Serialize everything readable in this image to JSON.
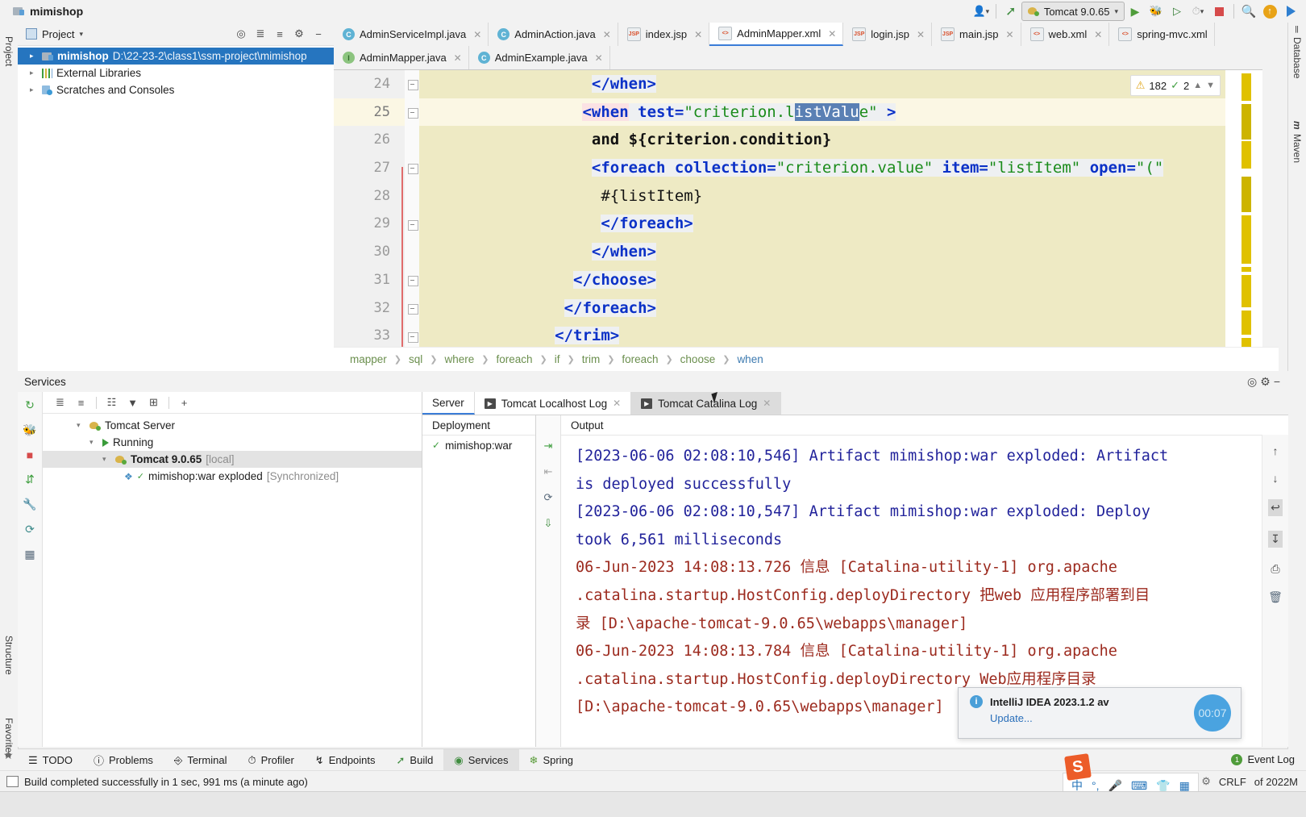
{
  "titlebar": {
    "project_name": "mimishop",
    "project_icon": "folder-module-icon",
    "account_icon": "user-avatar-icon",
    "build_icon": "hammer-build-icon",
    "run_config": {
      "label": "Tomcat 9.0.65",
      "icon": "tomcat-cat-icon",
      "dropdown_icon": "chevron-down-icon"
    },
    "actions": [
      {
        "name": "run-button",
        "glyph": "↪"
      },
      {
        "name": "debug-button",
        "glyph": "☸"
      },
      {
        "name": "run-with-coverage-button",
        "glyph": "▶"
      },
      {
        "name": "profiler-button",
        "glyph": "◴"
      },
      {
        "name": "stop-button",
        "glyph": "■"
      },
      {
        "name": "search-everywhere-button",
        "glyph": "⌕"
      },
      {
        "name": "updates-button",
        "glyph": "↑"
      },
      {
        "name": "next-button",
        "glyph": "▶"
      }
    ]
  },
  "left_rail": {
    "project_label": "Project",
    "structure_label": "Structure",
    "favorites_label": "Favorites",
    "star_icon": "star-icon"
  },
  "right_rail": {
    "database_label": "Database",
    "maven_label": "Maven"
  },
  "project_window": {
    "title": "Project",
    "dropdown_icon": "chevron-down-icon",
    "toolbar_icons": [
      "locate-icon",
      "expand-all-icon",
      "collapse-all-icon",
      "settings-gear-icon",
      "hide-icon"
    ],
    "tree": [
      {
        "label": "mimishop",
        "path": "D:\\22-23-2\\class1\\ssm-project\\mimishop",
        "icon": "project-folder-icon",
        "selected": true,
        "indent": 0
      },
      {
        "label": "External Libraries",
        "path": "",
        "icon": "libraries-icon",
        "selected": false,
        "indent": 0
      },
      {
        "label": "Scratches and Consoles",
        "path": "",
        "icon": "scratches-icon",
        "selected": false,
        "indent": 0
      }
    ]
  },
  "editor": {
    "tabs_row1": [
      {
        "label": "AdminServiceImpl.java",
        "icon": "java-class-icon",
        "active": false,
        "closable": true
      },
      {
        "label": "AdminAction.java",
        "icon": "java-class-icon",
        "active": false,
        "closable": true
      },
      {
        "label": "index.jsp",
        "icon": "jsp-file-icon",
        "active": false,
        "closable": true
      },
      {
        "label": "AdminMapper.xml",
        "icon": "xml-file-icon",
        "active": true,
        "closable": true
      },
      {
        "label": "login.jsp",
        "icon": "jsp-file-icon",
        "active": false,
        "closable": true
      },
      {
        "label": "main.jsp",
        "icon": "jsp-file-icon",
        "active": false,
        "closable": true
      },
      {
        "label": "web.xml",
        "icon": "xml-file-icon",
        "active": false,
        "closable": true
      },
      {
        "label": "spring-mvc.xml",
        "icon": "xml-file-icon",
        "active": false,
        "closable": true
      }
    ],
    "tabs_row2": [
      {
        "label": "AdminMapper.java",
        "icon": "java-interface-icon",
        "active": false,
        "closable": true
      },
      {
        "label": "AdminExample.java",
        "icon": "java-class-icon",
        "active": false,
        "closable": true
      }
    ],
    "inspection_widget": {
      "warning_count": "182",
      "ok_count": "2",
      "warning_icon": "warning-triangle-icon",
      "ok_icon": "checkmark-icon",
      "up_icon": "chevron-up-icon",
      "down_icon": "chevron-down-icon"
    },
    "line_numbers": [
      "24",
      "25",
      "26",
      "27",
      "28",
      "29",
      "30",
      "31",
      "32",
      "33"
    ],
    "current_line": "25",
    "selected_text": "istValu",
    "code_lines": [
      {
        "num": "24",
        "indent": 18,
        "text": "</when>"
      },
      {
        "num": "25",
        "indent": 17,
        "text": "<when test=\"criterion.listValue\" >"
      },
      {
        "num": "26",
        "indent": 18,
        "text": "and ${criterion.condition}"
      },
      {
        "num": "27",
        "indent": 18,
        "text": "<foreach collection=\"criterion.value\" item=\"listItem\" open=\"(\""
      },
      {
        "num": "28",
        "indent": 19,
        "text": "#{listItem}"
      },
      {
        "num": "29",
        "indent": 19,
        "text": "</foreach>"
      },
      {
        "num": "30",
        "indent": 18,
        "text": "</when>"
      },
      {
        "num": "31",
        "indent": 16,
        "text": "</choose>"
      },
      {
        "num": "32",
        "indent": 15,
        "text": "</foreach>"
      },
      {
        "num": "33",
        "indent": 14,
        "text": "</trim>"
      }
    ],
    "breadcrumbs": [
      "mapper",
      "sql",
      "where",
      "foreach",
      "if",
      "trim",
      "foreach",
      "choose",
      "when"
    ]
  },
  "services": {
    "title": "Services",
    "header_icons": [
      "locate-icon",
      "settings-gear-icon",
      "hide-icon"
    ],
    "rail_icons": [
      "rerun-icon",
      "debug-icon",
      "stop-icon",
      "redeploy-icon",
      "settings-wrench-icon",
      "restart-icon",
      "layout-icon"
    ],
    "toolbar_icons": [
      "expand-all-icon",
      "collapse-all-icon",
      "group-icon",
      "filter-icon",
      "add-tab-icon",
      "add-icon"
    ],
    "tree": [
      {
        "label": "Tomcat Server",
        "suffix": "",
        "icon": "tomcat-cat-icon",
        "indent": 0,
        "bold": false,
        "selected": false,
        "arrow": "⌄"
      },
      {
        "label": "Running",
        "suffix": "",
        "icon": "run-green-icon",
        "indent": 1,
        "bold": false,
        "selected": false,
        "arrow": "⌄"
      },
      {
        "label": "Tomcat 9.0.65",
        "suffix": "[local]",
        "icon": "tomcat-cat-icon",
        "indent": 2,
        "bold": true,
        "selected": true,
        "arrow": "⌄"
      },
      {
        "label": "mimishop:war exploded",
        "suffix": "[Synchronized]",
        "icon": "artifact-icon",
        "indent": 3,
        "bold": false,
        "selected": false,
        "arrow": ""
      }
    ],
    "console_tabs": [
      {
        "label": "Server",
        "icon": "",
        "active": true,
        "closable": false
      },
      {
        "label": "Tomcat Localhost Log",
        "icon": "log-icon",
        "active": false,
        "closable": true
      },
      {
        "label": "Tomcat Catalina Log",
        "icon": "log-icon",
        "active": false,
        "closable": true,
        "hovered": true
      }
    ],
    "deployment": {
      "column_header": "Deployment",
      "items": [
        {
          "label": "mimishop:war",
          "status_icon": "checkmark-icon"
        }
      ],
      "side_icons": [
        "deploy-icon",
        "undeploy-icon",
        "redeploy-icon",
        "update-icon"
      ]
    },
    "output": {
      "column_header": "Output",
      "side_icons": [
        "scroll-up-icon",
        "scroll-down-icon",
        "soft-wrap-icon",
        "scroll-to-end-icon",
        "print-icon",
        "clear-all-icon"
      ],
      "lines": [
        {
          "color": "blue",
          "text": "[2023-06-06 02:08:10,546] Artifact mimishop:war exploded: Artifact"
        },
        {
          "color": "blue",
          "text": "  is deployed successfully"
        },
        {
          "color": "blue",
          "text": "[2023-06-06 02:08:10,547] Artifact mimishop:war exploded: Deploy"
        },
        {
          "color": "blue",
          "text": "  took 6,561 milliseconds"
        },
        {
          "color": "red",
          "text": "06-Jun-2023 14:08:13.726 信息 [Catalina-utility-1] org.apache"
        },
        {
          "color": "red",
          "text": "  .catalina.startup.HostConfig.deployDirectory 把web 应用程序部署到目"
        },
        {
          "color": "red",
          "text": "  录 [D:\\apache-tomcat-9.0.65\\webapps\\manager]"
        },
        {
          "color": "red",
          "text": "06-Jun-2023 14:08:13.784 信息 [Catalina-utility-1] org.apache"
        },
        {
          "color": "red",
          "text": "  .catalina.startup.HostConfig.deployDirectory Web应用程序目录"
        },
        {
          "color": "red",
          "text": "  [D:\\apache-tomcat-9.0.65\\webapps\\manager]"
        }
      ]
    }
  },
  "notification": {
    "info_icon": "info-icon",
    "title": "IntelliJ IDEA 2023.1.2 av",
    "link": "Update...",
    "timer": "00:07"
  },
  "tool_strip": [
    {
      "label": "TODO",
      "icon": "todo-icon",
      "active": false
    },
    {
      "label": "Problems",
      "icon": "problems-icon",
      "active": false
    },
    {
      "label": "Terminal",
      "icon": "terminal-icon",
      "active": false
    },
    {
      "label": "Profiler",
      "icon": "profiler-icon",
      "active": false
    },
    {
      "label": "Endpoints",
      "icon": "endpoints-icon",
      "active": false
    },
    {
      "label": "Build",
      "icon": "build-hammer-icon",
      "active": false
    },
    {
      "label": "Services",
      "icon": "services-icon",
      "active": true
    },
    {
      "label": "Spring",
      "icon": "spring-leaf-icon",
      "active": false
    }
  ],
  "status_bar": {
    "icon": "build-status-icon",
    "message": "Build completed successfully in 1 sec, 991 ms (a minute ago)",
    "event_log": "Event Log",
    "event_count": "1",
    "line_separator": "CRLF",
    "memory": "of 2022M",
    "settings_icon": "settings-gear-icon"
  },
  "ime_bar": {
    "logo": "S",
    "items": [
      "中",
      "°,",
      "mic-icon",
      "keyboard-icon",
      "skin-icon",
      "apps-icon"
    ]
  }
}
